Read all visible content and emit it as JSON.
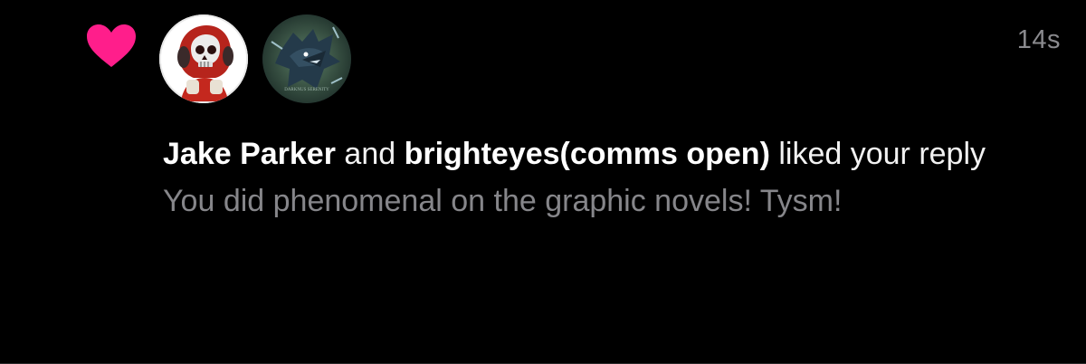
{
  "notification": {
    "type": "like",
    "timestamp": "14s",
    "users": [
      {
        "name": "Jake Parker",
        "avatar": "skull-astronaut-avatar"
      },
      {
        "name": "brighteyes(comms open)",
        "avatar": "dark-dragon-avatar"
      }
    ],
    "connector": "and",
    "action": "liked your reply",
    "reply_text": "You did phenomenal on the graphic novels! Tysm!",
    "avatar_2_caption": "DARKNUS SERENITY"
  },
  "colors": {
    "heart": "#ff1e8b",
    "background": "#000000",
    "primary_text": "#ffffff",
    "secondary_text": "#86868a"
  },
  "icons": {
    "like": "heart-icon"
  }
}
